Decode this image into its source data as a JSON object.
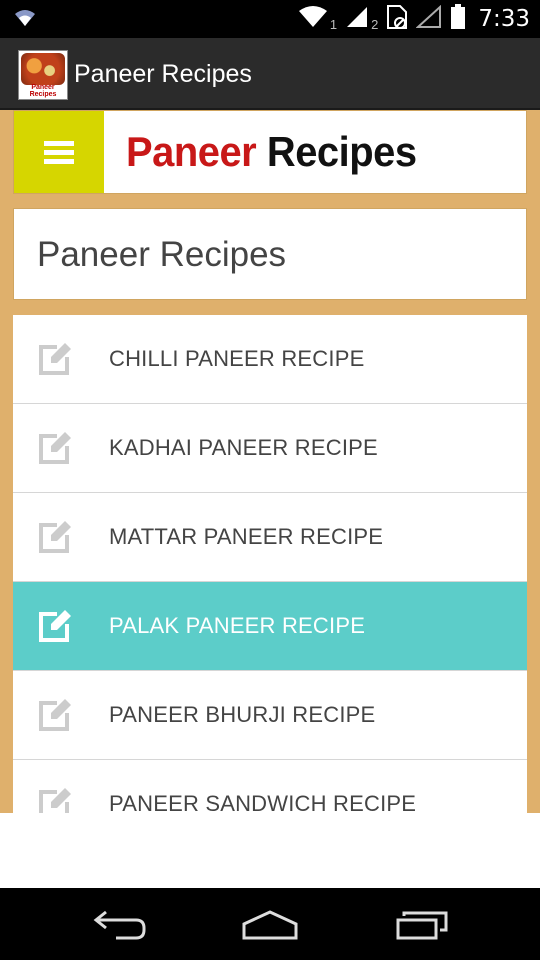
{
  "status_bar": {
    "time": "7:33",
    "sim1_label": "1",
    "sim2_label": "2",
    "icons": [
      "wifi-icon",
      "wifi-icon",
      "signal-icon",
      "signal-icon",
      "no-sim-icon",
      "signal-empty-icon",
      "battery-icon"
    ]
  },
  "action_bar": {
    "title": "Paneer Recipes",
    "app_icon_caption": "Paneer Recipes",
    "background": "#2b2b2b"
  },
  "banner": {
    "word1": "Paneer",
    "word2": "Recipes",
    "menu_button_color": "#d6d600",
    "word1_color": "#c81818"
  },
  "heading": {
    "text": "Paneer Recipes"
  },
  "recipes": [
    {
      "label": "CHILLI PANEER RECIPE",
      "icon": "edit-icon",
      "selected": false
    },
    {
      "label": "KADHAI PANEER RECIPE",
      "icon": "edit-icon",
      "selected": false
    },
    {
      "label": "MATTAR PANEER RECIPE",
      "icon": "edit-icon",
      "selected": false
    },
    {
      "label": "PALAK PANEER RECIPE",
      "icon": "edit-icon",
      "selected": true
    },
    {
      "label": "PANEER BHURJI RECIPE",
      "icon": "edit-icon",
      "selected": false
    },
    {
      "label": "PANEER SANDWICH RECIPE",
      "icon": "edit-icon",
      "selected": false
    }
  ],
  "colors": {
    "content_background": "#dfb06c",
    "selected_row": "#5ccdc9"
  },
  "nav_bar": {
    "icons": [
      "back-icon",
      "home-icon",
      "recent-apps-icon"
    ]
  }
}
